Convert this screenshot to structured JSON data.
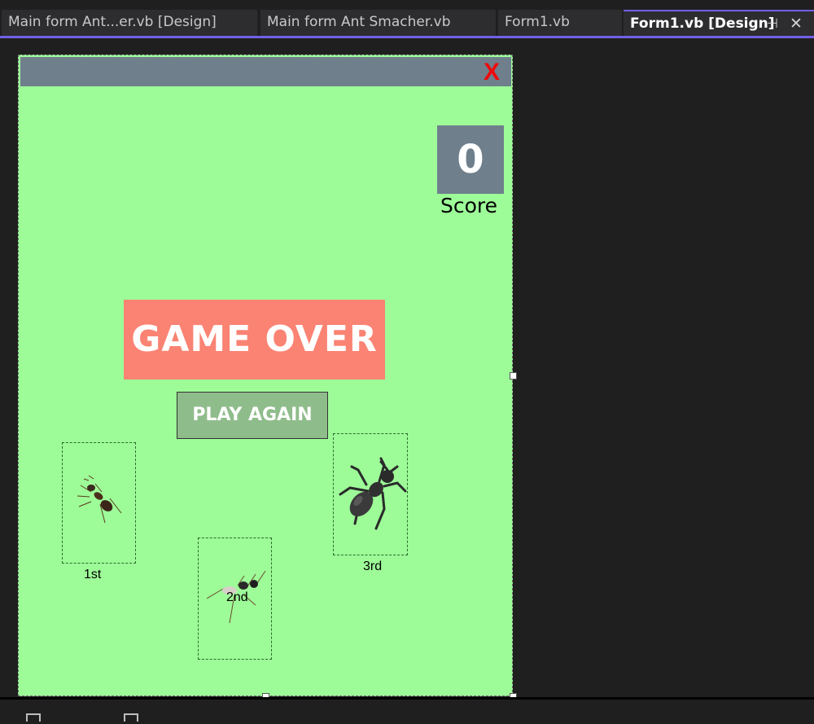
{
  "tabs": [
    {
      "label": "Main form Ant...er.vb [Design]"
    },
    {
      "label": "Main form Ant Smacher.vb"
    },
    {
      "label": "Form1.vb"
    },
    {
      "label": "Form1.vb [Design]"
    }
  ],
  "tab_buttons": {
    "pin": "⊣",
    "close": "✕"
  },
  "form": {
    "close_label": "X",
    "score_value": "0",
    "score_label": "Score",
    "game_over": "GAME OVER",
    "play_again": "PLAY AGAIN",
    "labels": {
      "first": "1st",
      "second": "2nd",
      "third": "3rd"
    }
  },
  "colors": {
    "accent": "#7160e8",
    "form_bg": "#9dfb98",
    "titlebar": "#6f7f8c",
    "game_over_bg": "#fa8373",
    "play_btn_bg": "#8fbc8b",
    "close_x": "#ee0a0a"
  },
  "icons": [
    "ant-icon",
    "pin-icon",
    "close-icon"
  ]
}
